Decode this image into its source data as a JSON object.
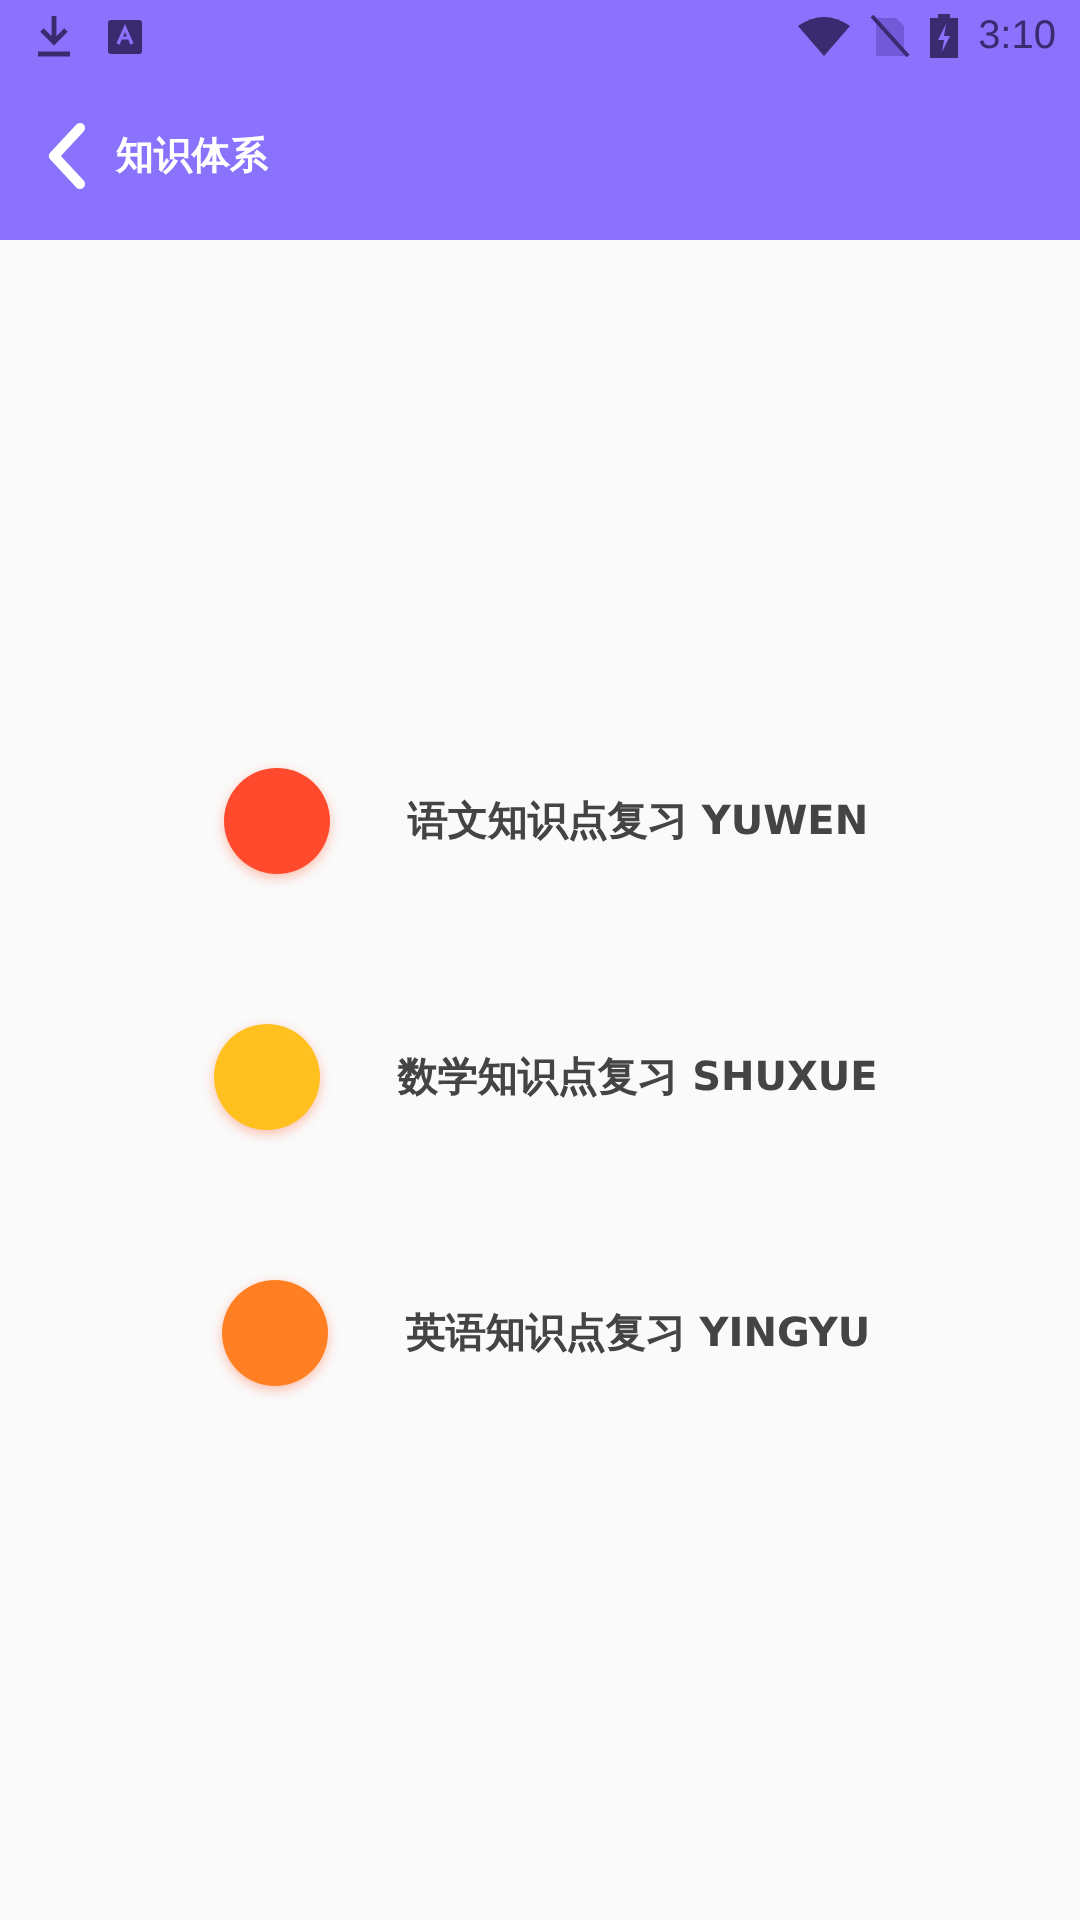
{
  "status_bar": {
    "time": "3:10"
  },
  "toolbar": {
    "title": "知识体系"
  },
  "items": [
    {
      "label": "语文知识点复习 YUWEN",
      "color": "#ff4a2e"
    },
    {
      "label": "数学知识点复习 SHUXUE",
      "color": "#ffc020"
    },
    {
      "label": "英语知识点复习 YINGYU",
      "color": "#ff7f22"
    }
  ]
}
